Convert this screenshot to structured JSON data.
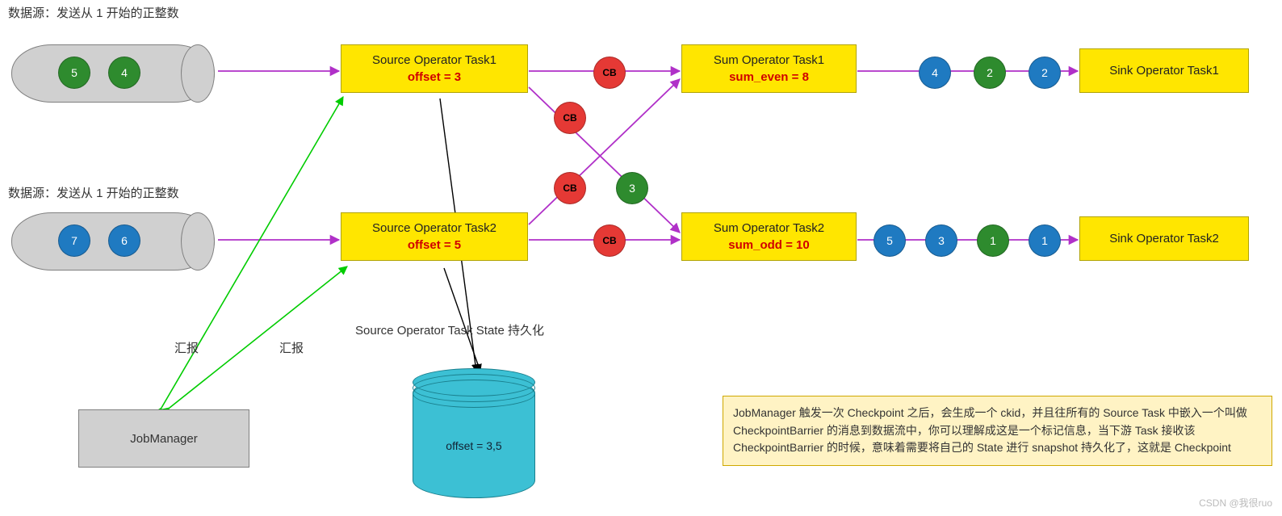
{
  "datasource": {
    "caption": "数据源：发送从 1 开始的正整数",
    "top_tokens": [
      "5",
      "4"
    ],
    "bottom_tokens": [
      "7",
      "6"
    ]
  },
  "source_ops": {
    "task1": {
      "title": "Source Operator Task1",
      "state": "offset = 3"
    },
    "task2": {
      "title": "Source Operator Task2",
      "state": "offset = 5"
    }
  },
  "sum_ops": {
    "task1": {
      "title": "Sum Operator Task1",
      "state": "sum_even = 8"
    },
    "task2": {
      "title": "Sum Operator Task2",
      "state": "sum_odd = 10"
    }
  },
  "sink_ops": {
    "task1": {
      "title": "Sink Operator Task1"
    },
    "task2": {
      "title": "Sink Operator Task2"
    }
  },
  "mid_tokens": {
    "cb": "CB",
    "green_val": "3",
    "row_top": {
      "vals": [
        "4",
        "2",
        "2"
      ],
      "colors": [
        "blue",
        "green",
        "blue"
      ]
    },
    "row_bot": {
      "vals": [
        "5",
        "3",
        "1",
        "1"
      ],
      "colors": [
        "blue",
        "blue",
        "green",
        "blue"
      ]
    }
  },
  "jobmanager": {
    "label": "JobManager"
  },
  "report_label": "汇报",
  "state_store": {
    "caption": "Source Operator Task State 持久化",
    "value": "offset = 3,5"
  },
  "note": {
    "text": "JobManager 触发一次 Checkpoint 之后，会生成一个 ckid，并且往所有的 Source Task 中嵌入一个叫做 CheckpointBarrier 的消息到数据流中，你可以理解成这是一个标记信息，当下游 Task 接收该 CheckpointBarrier 的时候，意味着需要将自己的 State 进行 snapshot 持久化了，这就是 Checkpoint"
  },
  "watermark": "CSDN @我很ruo",
  "colors": {
    "purple": "#b030c8",
    "green_line": "#00cc00",
    "black": "#000"
  }
}
